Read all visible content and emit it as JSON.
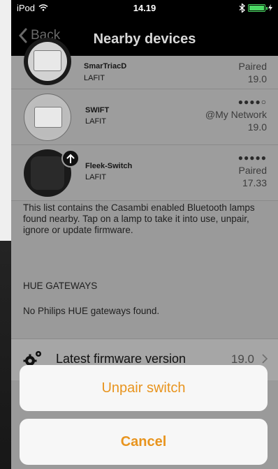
{
  "status_bar": {
    "carrier": "iPod",
    "time": "14.19"
  },
  "nav": {
    "back_label": "Back",
    "title": "Nearby devices"
  },
  "devices": [
    {
      "name": "SmarTriacD",
      "vendor": "LAFIT",
      "signal": "",
      "network": "Paired",
      "version": "19.0"
    },
    {
      "name": "SWIFT",
      "vendor": "LAFIT",
      "signal": "●●●●○",
      "network": "@My Network",
      "version": "19.0"
    },
    {
      "name": "Fleek-Switch",
      "vendor": "LAFIT",
      "signal": "●●●●●",
      "network": "Paired",
      "version": "17.33"
    }
  ],
  "info_text": "This list contains the Casambi enabled Bluetooth lamps found nearby. Tap on a lamp to take it into use, unpair, ignore or update firmware.",
  "hue": {
    "header": "HUE GATEWAYS",
    "empty_text": "No Philips HUE gateways found."
  },
  "firmware": {
    "label": "Latest firmware version",
    "value": "19.0"
  },
  "action_sheet": {
    "unpair_label": "Unpair switch",
    "cancel_label": "Cancel"
  },
  "colors": {
    "accent": "#e8941e",
    "battery": "#4cd964"
  }
}
